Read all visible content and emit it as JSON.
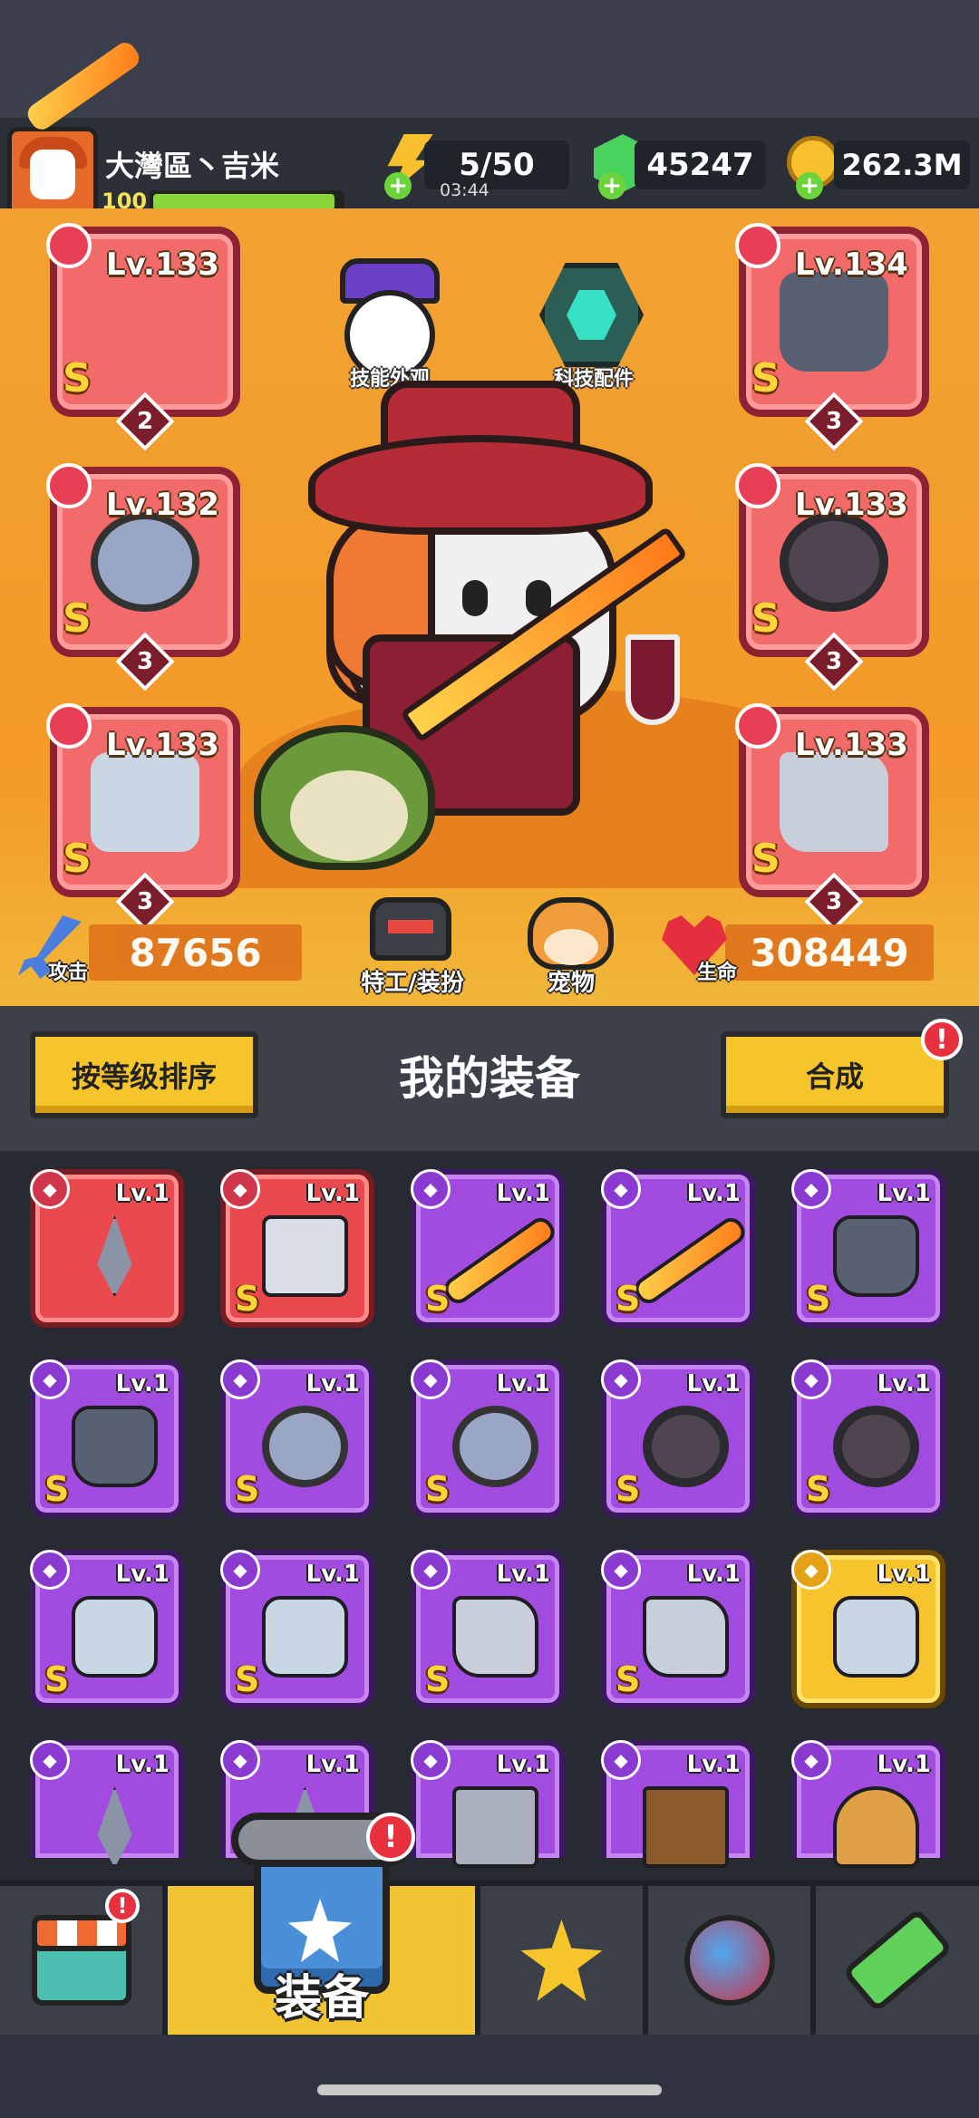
{
  "player": {
    "name": "大灣區丶吉米",
    "level": "100",
    "level_progress": 0.95
  },
  "resources": {
    "energy": "5/50",
    "energy_timer": "03:44",
    "gems": "45247",
    "coins": "262.3M"
  },
  "hero_panel": {
    "left_slots": [
      {
        "level": "Lv.133",
        "grade": "S",
        "stars": "2",
        "type": "weapon",
        "icon": "sword-icon"
      },
      {
        "level": "Lv.132",
        "grade": "S",
        "stars": "3",
        "type": "necklace",
        "icon": "necklace-icon"
      },
      {
        "level": "Lv.133",
        "grade": "S",
        "stars": "3",
        "type": "gloves",
        "icon": "glove-icon"
      }
    ],
    "right_slots": [
      {
        "level": "Lv.134",
        "grade": "S",
        "stars": "3",
        "type": "armor",
        "icon": "armor-icon"
      },
      {
        "level": "Lv.133",
        "grade": "S",
        "stars": "3",
        "type": "belt",
        "icon": "belt-icon"
      },
      {
        "level": "Lv.133",
        "grade": "S",
        "stars": "3",
        "type": "boots",
        "icon": "boots-icon"
      }
    ],
    "skill_look_label": "技能外观",
    "tech_parts_label": "科技配件",
    "attack_label": "攻击",
    "attack_value": "87656",
    "life_label": "生命",
    "life_value": "308449",
    "agent_label": "特工/装扮",
    "pet_label": "宠物"
  },
  "equipment_panel": {
    "title": "我的装备",
    "sort_button": "按等级排序",
    "merge_button": "合成",
    "merge_alert": "!"
  },
  "inventory": [
    {
      "level": "Lv.1",
      "grade": "",
      "rarity": "red",
      "icon": "kunai-icon"
    },
    {
      "level": "Lv.1",
      "grade": "S",
      "rarity": "red",
      "icon": "blaster-icon"
    },
    {
      "level": "Lv.1",
      "grade": "S",
      "rarity": "purple",
      "icon": "sword-icon"
    },
    {
      "level": "Lv.1",
      "grade": "S",
      "rarity": "purple",
      "icon": "sword-icon"
    },
    {
      "level": "Lv.1",
      "grade": "S",
      "rarity": "purple",
      "icon": "armor-icon"
    },
    {
      "level": "Lv.1",
      "grade": "S",
      "rarity": "purple",
      "icon": "armor-icon"
    },
    {
      "level": "Lv.1",
      "grade": "S",
      "rarity": "purple",
      "icon": "necklace-icon"
    },
    {
      "level": "Lv.1",
      "grade": "S",
      "rarity": "purple",
      "icon": "necklace-icon"
    },
    {
      "level": "Lv.1",
      "grade": "S",
      "rarity": "purple",
      "icon": "belt-icon"
    },
    {
      "level": "Lv.1",
      "grade": "S",
      "rarity": "purple",
      "icon": "belt-icon"
    },
    {
      "level": "Lv.1",
      "grade": "S",
      "rarity": "purple",
      "icon": "glove-icon"
    },
    {
      "level": "Lv.1",
      "grade": "S",
      "rarity": "purple",
      "icon": "glove-icon"
    },
    {
      "level": "Lv.1",
      "grade": "S",
      "rarity": "purple",
      "icon": "boots-icon"
    },
    {
      "level": "Lv.1",
      "grade": "S",
      "rarity": "purple",
      "icon": "boots-icon"
    },
    {
      "level": "Lv.1",
      "grade": "",
      "rarity": "gold",
      "icon": "glove-icon"
    },
    {
      "level": "Lv.1",
      "grade": "",
      "rarity": "purple",
      "icon": "kunai-icon"
    },
    {
      "level": "Lv.1",
      "grade": "",
      "rarity": "purple",
      "icon": "kunai-icon"
    },
    {
      "level": "Lv.1",
      "grade": "",
      "rarity": "purple",
      "icon": "revolver-icon"
    },
    {
      "level": "Lv.1",
      "grade": "",
      "rarity": "purple",
      "icon": "shotgun-icon"
    },
    {
      "level": "Lv.1",
      "grade": "",
      "rarity": "purple",
      "icon": "torch-icon"
    }
  ],
  "nav": {
    "tabs": [
      {
        "name": "shop",
        "icon": "shop-icon",
        "alert": "!"
      },
      {
        "name": "equipment",
        "label": "装备",
        "icon": "equipment-icon",
        "alert": "!"
      },
      {
        "name": "battle",
        "icon": "crossed-swords-icon"
      },
      {
        "name": "world",
        "icon": "planet-icon"
      },
      {
        "name": "evolve",
        "icon": "dna-icon"
      }
    ]
  },
  "colors": {
    "accent": "#f5c52b",
    "hero_bg": "#f39a27",
    "epic": "#a14be0",
    "mythic": "#ea4a4f",
    "legend": "#f6c52d"
  }
}
